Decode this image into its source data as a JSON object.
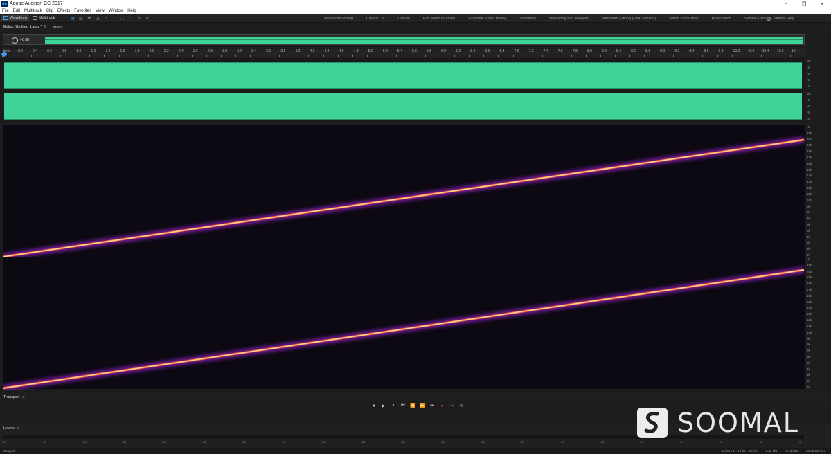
{
  "window": {
    "title": "Adobe Audition CC 2017",
    "icon": "Au",
    "controls": [
      "–",
      "❐",
      "✕"
    ]
  },
  "menu": [
    "File",
    "Edit",
    "Multitrack",
    "Clip",
    "Effects",
    "Favorites",
    "View",
    "Window",
    "Help"
  ],
  "toolbar": {
    "waveform_label": "Waveform",
    "multitrack_label": "Multitrack",
    "workspaces": [
      "Advanced Mixing",
      "Classic",
      "Default",
      "Edit Audio to Video",
      "Essential Video Mixing",
      "Loudness",
      "Mastering and Analysis",
      "Maximum Editing (Dual Monitor)",
      "Radio Production",
      "Restoration",
      "Simple Editing"
    ],
    "active_workspace": "Classic",
    "search_placeholder": "Search Help"
  },
  "editor": {
    "tab_label": "Editor: Untitled 1.wav *",
    "mixer_label": "Mixer"
  },
  "overview": {
    "hud_db": "+0 dB"
  },
  "ruler": {
    "unit": "hms",
    "ticks": [
      "0.2",
      "0.4",
      "0.6",
      "0.8",
      "1.0",
      "1.2",
      "1.4",
      "1.6",
      "1.8",
      "2.0",
      "2.2",
      "2.4",
      "2.6",
      "2.8",
      "3.0",
      "3.2",
      "3.4",
      "3.6",
      "3.8",
      "4.0",
      "4.2",
      "4.4",
      "4.6",
      "4.8",
      "5.0",
      "5.2",
      "5.4",
      "5.6",
      "5.8",
      "6.0",
      "6.2",
      "6.4",
      "6.6",
      "6.8",
      "7.0",
      "7.2",
      "7.4",
      "7.6",
      "7.8",
      "8.0",
      "8.2",
      "8.4",
      "8.6",
      "8.8",
      "9.0",
      "9.2",
      "9.4",
      "9.6",
      "9.8",
      "10.0",
      "10.2",
      "10.4",
      "10.6",
      "10."
    ]
  },
  "db_scale": [
    "dB",
    "-3",
    "-6",
    "-9",
    "-3"
  ],
  "hz_scale": [
    "Hz",
    "21k",
    "20k",
    "19k",
    "18k",
    "17k",
    "16k",
    "15k",
    "14k",
    "13k",
    "12k",
    "11k",
    "10k",
    "9k",
    "8k",
    "7k",
    "6k",
    "5k",
    "4k",
    "3k",
    "2k",
    "1k"
  ],
  "transport": {
    "label": "Transport",
    "buttons": [
      "■",
      "▶",
      "⏸",
      "⏮",
      "⏪",
      "⏩",
      "⏭",
      "●",
      "⇥",
      "⟲"
    ]
  },
  "levels": {
    "label": "Levels",
    "scale": [
      "dB",
      "-57",
      "-54",
      "-51",
      "-48",
      "-45",
      "-42",
      "-39",
      "-36",
      "-33",
      "-30",
      "-27",
      "-24",
      "-21",
      "-18",
      "-15",
      "-12",
      "-9",
      "-6",
      "-3",
      "0"
    ]
  },
  "status": {
    "left": "Stopped",
    "right": [
      "44100 Hz • 16-bit • Stereo",
      "1.82 MB",
      "0:10.823",
      "23.48 GB free"
    ]
  },
  "watermark": {
    "text": "SOOMAL"
  },
  "colors": {
    "waveform": "#3fd39a",
    "accent": "#3d9df5",
    "spectral_line": "#ffd27a"
  }
}
